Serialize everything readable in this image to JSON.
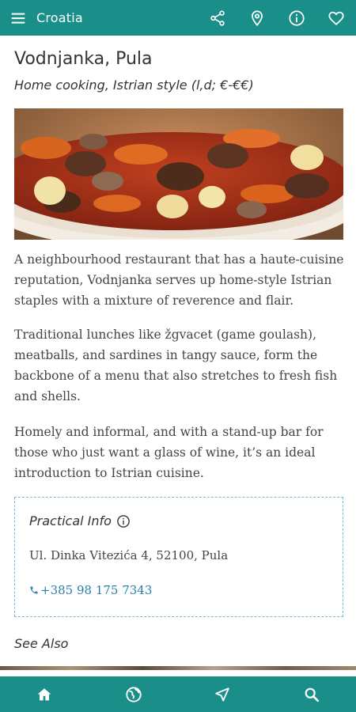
{
  "app_bar": {
    "title": "Croatia",
    "icons": [
      "menu-icon",
      "share-icon",
      "map-pin-icon",
      "info-icon",
      "heart-icon"
    ]
  },
  "place": {
    "name": "Vodnjanka, Pula",
    "subtitle": "Home cooking, Istrian style (l,d; €-€€)",
    "paragraphs": [
      "A neighbourhood restaurant that has a haute-cuisine reputation, Vodnjanka serves up home-style Istrian staples with a mixture of reverence and flair.",
      "Traditional lunches like žgvacet (game goulash), meatballs, and sardines in tangy sauce, form the backbone of a menu that also stretches to fresh fish and shells.",
      "Homely and informal, and with a stand-up bar for those who just want a glass of wine, it’s an ideal introduction to Istrian cuisine."
    ]
  },
  "practical_info": {
    "title": "Practical Info",
    "address": "Ul. Dinka Vitezića 4, 52100, Pula",
    "phone": "+385 98 175 7343"
  },
  "see_also": "See Also",
  "bottom_nav": {
    "icons": [
      "home-icon",
      "globe-icon",
      "navigation-icon",
      "search-icon"
    ]
  },
  "colors": {
    "primary": "#1a8f8a",
    "link": "#2a7fa8",
    "info_border": "#7fb8d6"
  }
}
